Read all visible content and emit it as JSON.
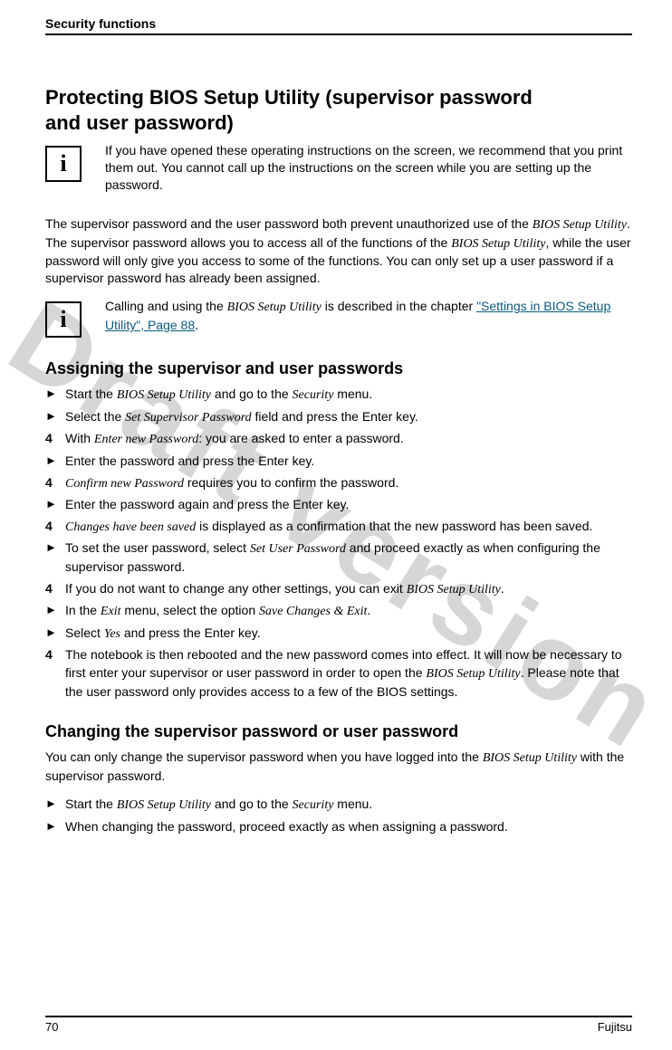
{
  "header": {
    "title": "Security functions"
  },
  "h1": {
    "line1": "Protecting BIOS Setup Utility (supervisor password",
    "line2": "and user password)"
  },
  "info1": {
    "text": "If you have opened these operating instructions on the screen, we recommend that you print them out.  You cannot call up the instructions on the screen while you are setting up the password."
  },
  "para1": {
    "p1a": "The supervisor password and the user password both prevent unauthorized use of the ",
    "p1b": "BIOS Setup Utility",
    "p1c": ". The supervisor password allows you to access all of the functions of the ",
    "p1d": "BIOS Setup Utility",
    "p1e": ", while the user password will only give you access to some of the functions. You can only set up a user password if a supervisor password has already been assigned."
  },
  "info2": {
    "a": "Calling and using the ",
    "b": "BIOS Setup Utility",
    "c": " is described in the chapter ",
    "link": "\"Settings in BIOS Setup Utility\", Page 88",
    "d": "."
  },
  "h2a": "Assigning the supervisor and user passwords",
  "steps_a": [
    {
      "type": "arrow",
      "parts": [
        "Start the ",
        "BIOS Setup Utility",
        " and go to the ",
        "Security",
        " menu."
      ]
    },
    {
      "type": "arrow",
      "parts": [
        "Select the ",
        "Set Supervisor Password",
        " field and press the Enter key."
      ]
    },
    {
      "type": "check",
      "parts": [
        "With ",
        "Enter new Password",
        ":  you are asked to enter a password."
      ]
    },
    {
      "type": "arrow",
      "parts": [
        "Enter the password and press the Enter key."
      ]
    },
    {
      "type": "check",
      "parts": [
        "",
        "Confirm new Password",
        " requires you to confirm the password."
      ]
    },
    {
      "type": "arrow",
      "parts": [
        "Enter the password again and press the Enter key."
      ]
    },
    {
      "type": "check",
      "parts": [
        "",
        "Changes have been saved",
        " is displayed as a confirmation that the new password has been saved."
      ]
    },
    {
      "type": "arrow",
      "parts": [
        "To set the user password, select ",
        "Set User Password",
        " and proceed exactly as when configuring the supervisor password."
      ]
    },
    {
      "type": "check",
      "parts": [
        "If you do not want to change any other settings, you can exit ",
        "BIOS Setup Utility",
        "."
      ]
    },
    {
      "type": "arrow",
      "parts": [
        "In the ",
        "Exit",
        " menu, select the option ",
        "Save Changes & Exit",
        "."
      ]
    },
    {
      "type": "arrow",
      "parts": [
        "Select ",
        "Yes",
        " and press the Enter key."
      ]
    },
    {
      "type": "check",
      "parts": [
        "The notebook is then rebooted and the new password comes into effect. It will now be necessary to first enter your supervisor or user password in order to open the ",
        "BIOS Setup Utility",
        ". Please note that the user password only provides access to a few of the BIOS settings."
      ]
    }
  ],
  "h2b": "Changing the supervisor password or user password",
  "para2": {
    "a": "You can only change the supervisor password when you have logged into the ",
    "b": "BIOS Setup Utility",
    "c": " with the supervisor password."
  },
  "steps_b": [
    {
      "type": "arrow",
      "parts": [
        "Start the ",
        "BIOS Setup Utility",
        " and go to the ",
        "Security",
        " menu."
      ]
    },
    {
      "type": "arrow",
      "parts": [
        "When changing the password, proceed exactly as when assigning a password."
      ]
    }
  ],
  "footer": {
    "page": "70",
    "brand": "Fujitsu"
  },
  "watermark": "Draft version"
}
